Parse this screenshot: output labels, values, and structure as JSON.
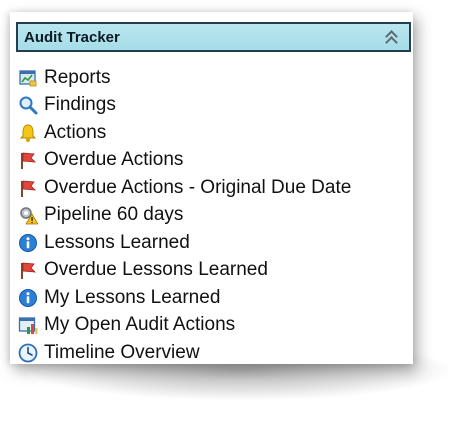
{
  "panel": {
    "title": "Audit Tracker",
    "collapse_icon": "double-chevron-up-icon"
  },
  "colors": {
    "header_bg": "#a9dfe9",
    "header_border": "#233f4f",
    "link_text": "#111111"
  },
  "menu": {
    "items": [
      {
        "label": "Reports",
        "icon": "chart-report-icon"
      },
      {
        "label": "Findings",
        "icon": "magnifier-icon"
      },
      {
        "label": "Actions",
        "icon": "bell-icon"
      },
      {
        "label": "Overdue Actions",
        "icon": "red-flag-icon"
      },
      {
        "label": "Overdue Actions - Original Due Date",
        "icon": "red-flag-icon"
      },
      {
        "label": "Pipeline 60 days",
        "icon": "warning-gear-icon"
      },
      {
        "label": "Lessons Learned",
        "icon": "info-icon"
      },
      {
        "label": "Overdue Lessons Learned",
        "icon": "red-flag-icon"
      },
      {
        "label": "My Lessons Learned",
        "icon": "info-icon"
      },
      {
        "label": "My Open Audit Actions",
        "icon": "bar-chart-icon"
      },
      {
        "label": "Timeline Overview",
        "icon": "clock-icon"
      }
    ]
  }
}
